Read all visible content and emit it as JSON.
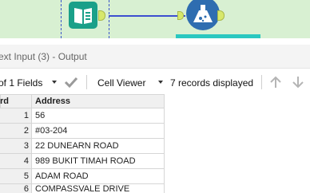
{
  "canvas": {
    "background": "#d8f0d2",
    "connector_color": "#3d4fd0"
  },
  "results": {
    "title": "ext Input (3) - Output"
  },
  "toolbar": {
    "fields_label": "of 1 Fields",
    "viewer_label": "Cell Viewer",
    "records_label": "7 records displayed"
  },
  "table": {
    "columns": [
      "rd",
      "Address"
    ],
    "rows": [
      {
        "num": "1",
        "address": "56"
      },
      {
        "num": "2",
        "address": "#03-204"
      },
      {
        "num": "3",
        "address": "22 DUNEARN ROAD"
      },
      {
        "num": "4",
        "address": "989 BUKIT TIMAH ROAD"
      },
      {
        "num": "5",
        "address": "ADAM ROAD"
      },
      {
        "num": "6",
        "address": "COMPASSVALE DRIVE"
      }
    ]
  }
}
